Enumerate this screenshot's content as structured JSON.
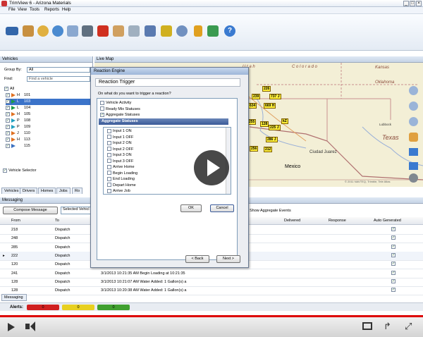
{
  "window": {
    "title": "TrimView 6 - Arizona Materials"
  },
  "menu": [
    "File",
    "View",
    "Tools",
    "Reports",
    "Help"
  ],
  "toolbar_icons": [
    "truck-icon",
    "map-pin-icon",
    "chart-icon",
    "globe-icon",
    "window-icon",
    "report-icon",
    "person-icon",
    "edit-icon",
    "route-icon",
    "lock-icon",
    "wand-icon",
    "gear-icon",
    "document-icon",
    "import-icon",
    "help-icon"
  ],
  "left_panel": {
    "header": "Vehicles",
    "group_by_label": "Group By:",
    "group_by_value": "All",
    "find_label": "Find:",
    "find_value": "Find a vehicle",
    "tree_root": "All",
    "vehicles": [
      {
        "code": "H",
        "num": "101"
      },
      {
        "code": "L",
        "num": "103"
      },
      {
        "code": "L",
        "num": "104"
      },
      {
        "code": "H",
        "num": "105"
      },
      {
        "code": "P",
        "num": "108"
      },
      {
        "code": "P",
        "num": "109"
      },
      {
        "code": "J",
        "num": "110"
      },
      {
        "code": "H",
        "num": "113"
      },
      {
        "code": "",
        "num": "115"
      }
    ],
    "vehicle_selector": "Vehicle Selector",
    "tabs": [
      "Vehicles",
      "Drivers",
      "Homes",
      "Jobs",
      "Ro"
    ]
  },
  "map": {
    "header": "Live Map",
    "states": [
      "U t a h",
      "C o l o r a d o",
      "Kansas",
      "Oklahoma",
      "Texas"
    ],
    "cities": [
      "Lubbock",
      "Ciudad Juarez"
    ],
    "country": "Mexico",
    "vehicle_labels": [
      "226",
      "239",
      "737 J",
      "634",
      "669 H",
      "255",
      "128",
      "225 J",
      "256",
      "212",
      "286 J",
      "kZ"
    ],
    "copyright": "© 2011 NAVTEQ, Trimble, Tele Atlas"
  },
  "dialog": {
    "app_title": "Reaction Engine",
    "title": "Reaction Trigger",
    "question": "On what do you want to trigger a reaction?",
    "triggers": [
      {
        "label": "Vehicle Activity",
        "checked": false
      },
      {
        "label": "Ready Mix Statuses",
        "checked": false
      },
      {
        "label": "Aggregate Statuses",
        "checked": true
      }
    ],
    "group_header": "Aggregate Statuses",
    "statuses": [
      "Input 1 ON",
      "Input 1 OFF",
      "Input 2 ON",
      "Input 2 OFF",
      "Input 3 ON",
      "Input 3 OFF",
      "Arrive Home",
      "Begin Loading",
      "End Loading",
      "Depart Home",
      "Arrive Job"
    ],
    "ok": "OK",
    "cancel": "Cancel",
    "back": "< Back",
    "next": "Next >"
  },
  "messaging": {
    "header": "Messaging",
    "compose": "Compose Message",
    "selected": "Selected Vehicl",
    "show_aggregate": "Show Aggregate Events",
    "columns": [
      "From",
      "To",
      "Delivered",
      "Response",
      "Auto Generated"
    ],
    "rows": [
      {
        "from": "218",
        "to": "Dispatch",
        "msg": ""
      },
      {
        "from": "248",
        "to": "Dispatch",
        "msg": ""
      },
      {
        "from": "285",
        "to": "Dispatch",
        "msg": ""
      },
      {
        "from": "222",
        "to": "Dispatch",
        "msg": ""
      },
      {
        "from": "120",
        "to": "Dispatch",
        "msg": ""
      },
      {
        "from": "241",
        "to": "Dispatch",
        "msg": "3/1/2013 10:21:35 AM  Begin Loading at 10:21:35"
      },
      {
        "from": "128",
        "to": "Dispatch",
        "msg": "3/1/2013 10:21:07 AM  Water Added: 1 Gallon(s) a"
      },
      {
        "from": "128",
        "to": "Dispatch",
        "msg": "3/1/2013 10:20:38 AM  Water Added: 1 Gallon(s) a"
      }
    ],
    "tab": "Messaging",
    "alerts_label": "Alerts:",
    "alerts": [
      {
        "count": "0",
        "color": "#d02020"
      },
      {
        "count": "0",
        "color": "#e8d020"
      },
      {
        "count": "0",
        "color": "#40a030"
      }
    ]
  },
  "colors": {
    "selection": "#3b73c9",
    "titlebar": "#9eb6d8",
    "progress": "#dd0000"
  }
}
